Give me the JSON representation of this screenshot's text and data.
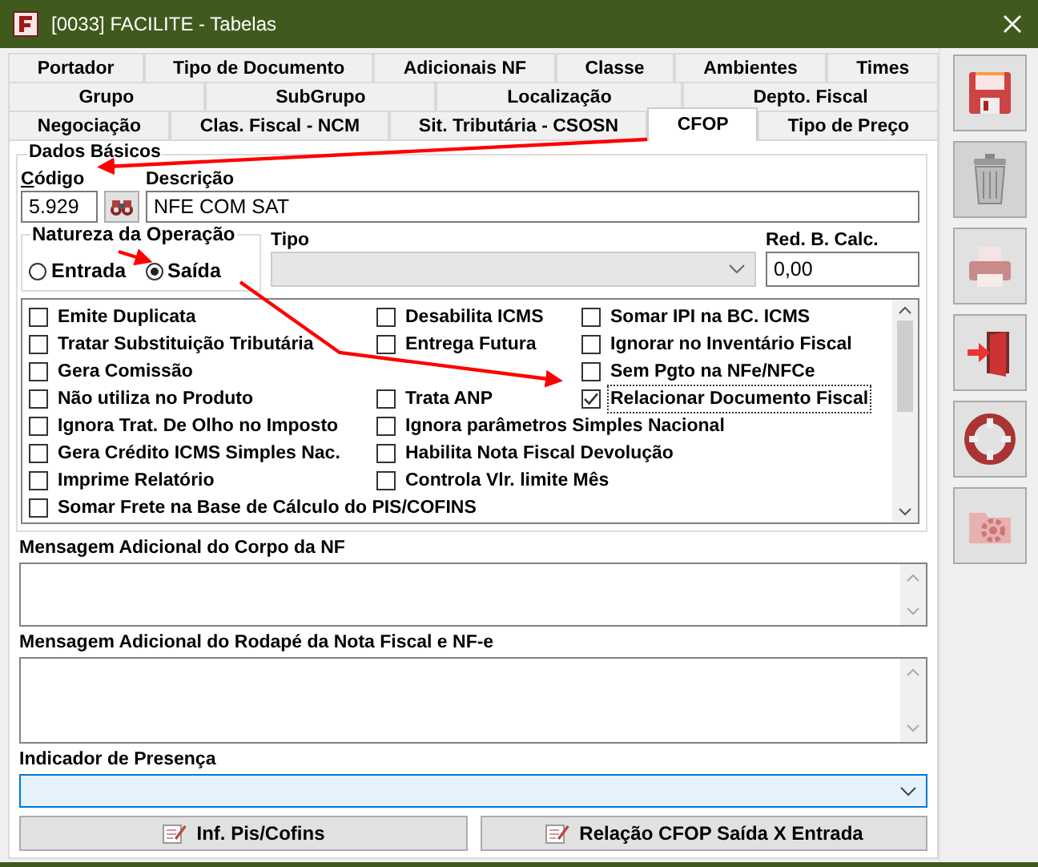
{
  "window": {
    "title": "[0033] FACILITE - Tabelas"
  },
  "tab_rows": [
    [
      {
        "label": "Portador",
        "selected": false
      },
      {
        "label": "Tipo de Documento",
        "selected": false
      },
      {
        "label": "Adicionais NF",
        "selected": false
      },
      {
        "label": "Classe",
        "selected": false
      },
      {
        "label": "Ambientes",
        "selected": false
      },
      {
        "label": "Times",
        "selected": false
      }
    ],
    [
      {
        "label": "Grupo",
        "selected": false
      },
      {
        "label": "SubGrupo",
        "selected": false
      },
      {
        "label": "Localização",
        "selected": false
      },
      {
        "label": "Depto. Fiscal",
        "selected": false
      }
    ],
    [
      {
        "label": "Negociação",
        "selected": false
      },
      {
        "label": "Clas. Fiscal - NCM",
        "selected": false
      },
      {
        "label": "Sit. Tributária - CSOSN",
        "selected": false
      },
      {
        "label": "CFOP",
        "selected": true
      },
      {
        "label": "Tipo de Preço",
        "selected": false
      }
    ]
  ],
  "basic_data": {
    "title": "Dados Básicos",
    "code_label": "Código",
    "code_value": "5.929",
    "description_label": "Descrição",
    "description_value": "NFE COM SAT",
    "operation": {
      "title": "Natureza da Operação",
      "options": [
        {
          "label": "Entrada",
          "selected": false
        },
        {
          "label": "Saída",
          "selected": true
        }
      ]
    },
    "type_label": "Tipo",
    "reduction_label": "Red. B. Calc.",
    "reduction_value": "0,00",
    "options": [
      {
        "column_1": {
          "label": "Emite Duplicata",
          "checked": false
        },
        "column_2": {
          "label": "Desabilita ICMS",
          "checked": false
        },
        "column_3": {
          "label": "Somar IPI na BC. ICMS",
          "checked": false
        }
      },
      {
        "column_1": {
          "label": "Tratar Substituição Tributária",
          "checked": false
        },
        "column_2": {
          "label": "Entrega Futura",
          "checked": false
        },
        "column_3": {
          "label": "Ignorar no Inventário Fiscal",
          "checked": false
        }
      },
      {
        "column_1": {
          "label": "Gera Comissão",
          "checked": false
        },
        "column_3": {
          "label": "Sem Pgto na NFe/NFCe",
          "checked": false
        }
      },
      {
        "column_1": {
          "label": "Não utiliza no Produto",
          "checked": false
        },
        "column_2": {
          "label": "Trata ANP",
          "checked": false
        },
        "column_3": {
          "label": "Relacionar Documento Fiscal",
          "checked": true
        }
      },
      {
        "column_1": {
          "label": "Ignora Trat. De Olho no Imposto",
          "checked": false
        },
        "column_2": {
          "label": "Ignora parâmetros Simples Nacional",
          "checked": false
        }
      },
      {
        "column_1": {
          "label": "Gera Crédito ICMS Simples Nac.",
          "checked": false
        },
        "column_2": {
          "label": "Habilita Nota Fiscal Devolução",
          "checked": false
        }
      },
      {
        "column_1": {
          "label": "Imprime Relatório",
          "checked": false
        },
        "column_2": {
          "label": "Controla Vlr. limite Mês",
          "checked": false
        }
      },
      {
        "column_1": {
          "label": "Somar Frete na Base de Cálculo do PIS/COFINS",
          "checked": false
        }
      }
    ]
  },
  "body_message": {
    "label": "Mensagem Adicional do Corpo da NF"
  },
  "footer_message": {
    "label": "Mensagem Adicional do Rodapé da Nota Fiscal e NF-e"
  },
  "presence": {
    "label": "Indicador de Presença"
  },
  "buttons": [
    {
      "label": "Inf. Pis/Cofins"
    },
    {
      "label": "Relação CFOP Saída X Entrada"
    }
  ]
}
